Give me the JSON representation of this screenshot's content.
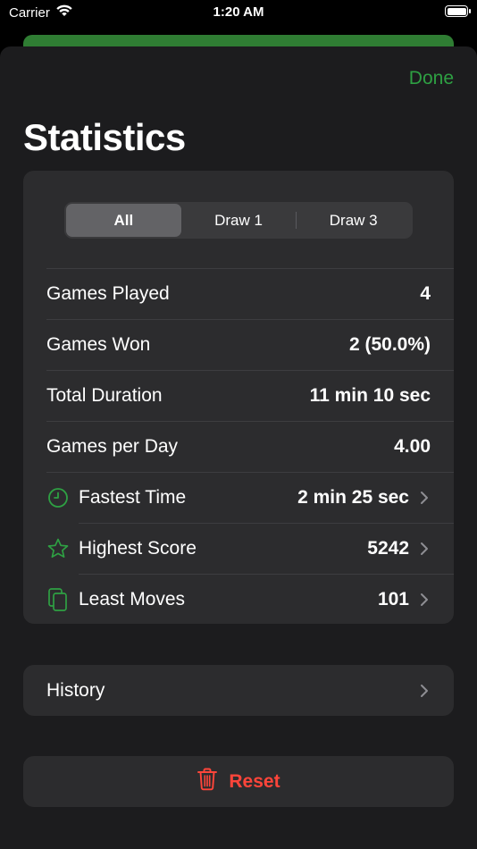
{
  "status_bar": {
    "carrier": "Carrier",
    "time": "1:20 AM"
  },
  "header": {
    "done_label": "Done",
    "title": "Statistics"
  },
  "segments": [
    {
      "label": "All",
      "selected": true
    },
    {
      "label": "Draw 1",
      "selected": false
    },
    {
      "label": "Draw 3",
      "selected": false
    }
  ],
  "stats": {
    "games_played": {
      "label": "Games Played",
      "value": "4"
    },
    "games_won": {
      "label": "Games Won",
      "value": "2 (50.0%)"
    },
    "total_duration": {
      "label": "Total Duration",
      "value": "11 min 10 sec"
    },
    "games_per_day": {
      "label": "Games per Day",
      "value": "4.00"
    },
    "fastest_time": {
      "label": "Fastest Time",
      "value": "2 min 25 sec",
      "icon": "clock-icon"
    },
    "highest_score": {
      "label": "Highest Score",
      "value": "5242",
      "icon": "star-icon"
    },
    "least_moves": {
      "label": "Least Moves",
      "value": "101",
      "icon": "cards-icon"
    }
  },
  "history": {
    "label": "History"
  },
  "reset": {
    "label": "Reset",
    "icon": "trash-icon"
  },
  "colors": {
    "accent": "#2ea043",
    "destructive": "#ff453a",
    "sheet_background": "#1c1c1e",
    "card_background": "#2c2c2e"
  }
}
